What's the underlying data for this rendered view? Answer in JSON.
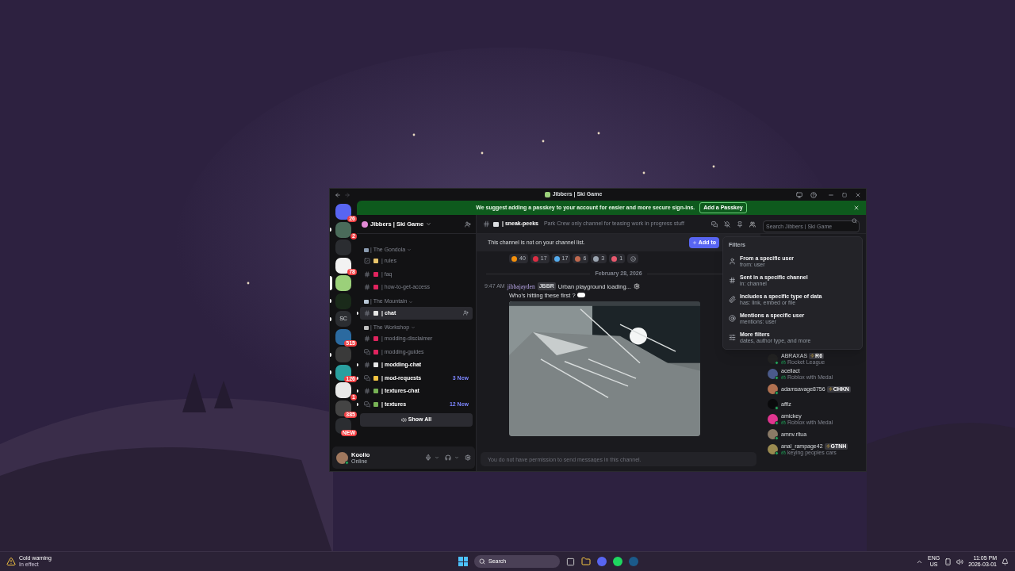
{
  "window": {
    "title": "Jibbers | Ski Game"
  },
  "banner": {
    "text": "We suggest adding a passkey to your account for easier and more secure sign-ins.",
    "button": "Add a Passkey"
  },
  "servers": [
    {
      "badge": "26",
      "selected": false,
      "unread": false
    },
    {
      "badge": "2",
      "selected": false,
      "unread": true
    },
    {
      "selected": false,
      "unread": false
    },
    {
      "badge": "78",
      "selected": false,
      "unread": false
    },
    {
      "selected": true,
      "unread": false
    },
    {
      "selected": false,
      "unread": true
    },
    {
      "label": "SC",
      "selected": false,
      "unread": true
    },
    {
      "badge": "515",
      "selected": false,
      "unread": false
    },
    {
      "selected": false,
      "unread": true
    },
    {
      "badge": "126",
      "selected": false,
      "unread": true
    },
    {
      "badge": "1",
      "selected": false,
      "unread": false
    },
    {
      "badge": "385",
      "selected": false,
      "unread": false
    },
    {
      "badge": "NEW",
      "selected": false,
      "unread": false
    }
  ],
  "server_name": "Jibbers | Ski Game",
  "categories": [
    {
      "name": "| The Gondola",
      "color": "#8a9bb0",
      "channels": [
        {
          "kind": "rules",
          "name": "| rules",
          "color": "#e8c46a",
          "unread": false,
          "selected": false
        },
        {
          "kind": "text",
          "name": "| faq",
          "color": "#e0245e",
          "unread": false,
          "selected": false
        },
        {
          "kind": "text",
          "name": "| how-to-get-access",
          "color": "#e0245e",
          "unread": false,
          "selected": false
        }
      ]
    },
    {
      "name": "| The Mountain",
      "color": "#b9c7d6",
      "channels": [
        {
          "kind": "text",
          "name": "| chat",
          "color": "#e6e6e6",
          "unread": true,
          "selected": true
        }
      ]
    },
    {
      "name": "| The Workshop",
      "color": "#c0c0c0",
      "channels": [
        {
          "kind": "text",
          "name": "| modding-disclaimer",
          "color": "#e0245e",
          "unread": false,
          "selected": false
        },
        {
          "kind": "forum",
          "name": "| modding-guides",
          "color": "#e0245e",
          "unread": false,
          "selected": false
        },
        {
          "kind": "text",
          "name": "| modding-chat",
          "color": "#e6e6e6",
          "unread": true,
          "selected": false
        },
        {
          "kind": "forum",
          "name": "| mod-requests",
          "color": "#f5c542",
          "unread": true,
          "selected": false,
          "badge": "3 New"
        },
        {
          "kind": "text",
          "name": "| textures-chat",
          "color": "#77b255",
          "unread": true,
          "selected": false
        },
        {
          "kind": "forum",
          "name": "| textures",
          "color": "#77b255",
          "unread": true,
          "selected": false,
          "badge": "12 New"
        }
      ]
    }
  ],
  "show_all": "Show All",
  "user": {
    "name": "Koolio",
    "status": "Online"
  },
  "channel": {
    "name": "| sneak-peeks",
    "topic": "Park Crew only channel for teasing work in progress stuff"
  },
  "notice": {
    "text": "This channel is not on your channel list.",
    "button": "Add to"
  },
  "search": {
    "placeholder": "Search Jibbers | Ski Game"
  },
  "reactions": [
    {
      "count": "40",
      "color": "#f4900c"
    },
    {
      "count": "17",
      "color": "#dd2e44"
    },
    {
      "count": "17",
      "color": "#55acee"
    },
    {
      "count": "6",
      "color": "#c1694f"
    },
    {
      "count": "3",
      "color": "#9aa4b0"
    },
    {
      "count": "1",
      "color": "#e8596e"
    }
  ],
  "date_divider": "February 28, 2026",
  "message": {
    "time": "9:47 AM",
    "author": "jibbajayden",
    "tag": "JBBR",
    "lines": [
      "Urban playground loading...",
      "Who's hitting these first ?"
    ]
  },
  "composer": {
    "placeholder": "You do not have permission to send messages in this channel."
  },
  "filters": {
    "title": "Filters",
    "items": [
      {
        "kind": "user",
        "title": "From a specific user",
        "hint": "from: user"
      },
      {
        "kind": "channel",
        "title": "Sent in a specific channel",
        "hint": "in: channel"
      },
      {
        "kind": "data",
        "title": "Includes a specific type of data",
        "hint": "has: link, embed or file"
      },
      {
        "kind": "mention",
        "title": "Mentions a specific user",
        "hint": "mentions: user"
      },
      {
        "kind": "more",
        "title": "More filters",
        "hint": "dates, author type, and more"
      }
    ]
  },
  "members": [
    {
      "name": "ABRAXAS",
      "tag": "R6",
      "activity": "Rocket League",
      "color": "#222222"
    },
    {
      "name": "acellact",
      "activity": "Roblox with Medal",
      "color": "#4a5a8a"
    },
    {
      "name": "adamsavage8756",
      "tag": "CHKN",
      "color": "#b07050"
    },
    {
      "name": "affiz",
      "color": "#0a0a0c"
    },
    {
      "name": "amickey",
      "activity": "Roblox with Medal",
      "color": "#e0358f"
    },
    {
      "name": "amnv.rltua",
      "color": "#8a7a66"
    },
    {
      "name": "anal_rampage42",
      "tag": "GTNH",
      "activity": "keying peoples cars",
      "color": "#9a8a50"
    }
  ],
  "taskbar": {
    "weather_title": "Cold warning",
    "weather_sub": "In effect",
    "search": "Search",
    "lang": "ENG",
    "region": "US",
    "time": "11:05 PM",
    "date": "2026-03-01"
  }
}
